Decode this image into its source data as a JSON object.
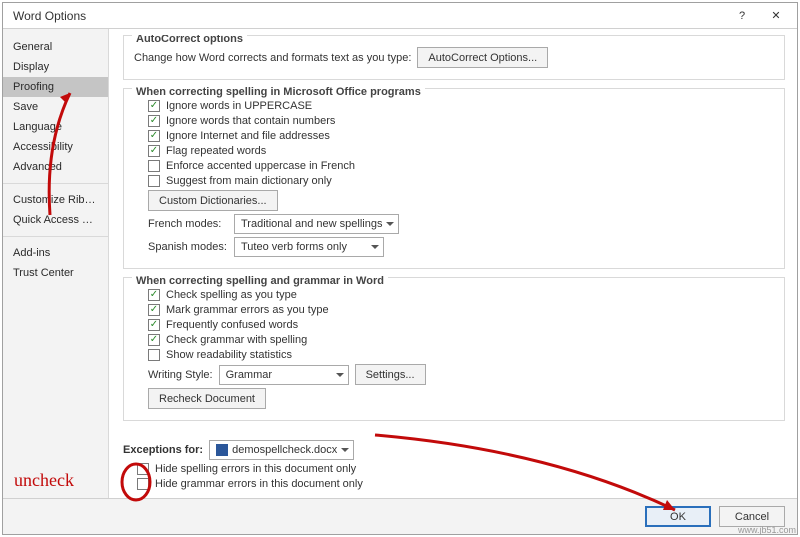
{
  "window": {
    "title": "Word Options",
    "help": "?",
    "close": "✕"
  },
  "sidebar": {
    "items": [
      {
        "label": "General"
      },
      {
        "label": "Display"
      },
      {
        "label": "Proofing",
        "selected": true
      },
      {
        "label": "Save"
      },
      {
        "label": "Language"
      },
      {
        "label": "Accessibility"
      },
      {
        "label": "Advanced"
      }
    ],
    "items2": [
      {
        "label": "Customize Ribbon"
      },
      {
        "label": "Quick Access Toolbar"
      }
    ],
    "items3": [
      {
        "label": "Add-ins"
      },
      {
        "label": "Trust Center"
      }
    ]
  },
  "autocorrect": {
    "section": "AutoCorrect options",
    "text": "Change how Word corrects and formats text as you type:",
    "button": "AutoCorrect Options..."
  },
  "spelling_office": {
    "section": "When correcting spelling in Microsoft Office programs",
    "c1": "Ignore words in UPPERCASE",
    "c2": "Ignore words that contain numbers",
    "c3": "Ignore Internet and file addresses",
    "c4": "Flag repeated words",
    "c5": "Enforce accented uppercase in French",
    "c6": "Suggest from main dictionary only",
    "custom_btn": "Custom Dictionaries...",
    "french_label": "French modes:",
    "french_val": "Traditional and new spellings",
    "spanish_label": "Spanish modes:",
    "spanish_val": "Tuteo verb forms only"
  },
  "spelling_word": {
    "section": "When correcting spelling and grammar in Word",
    "c1": "Check spelling as you type",
    "c2": "Mark grammar errors as you type",
    "c3": "Frequently confused words",
    "c4": "Check grammar with spelling",
    "c5": "Show readability statistics",
    "ws_label": "Writing Style:",
    "ws_val": "Grammar",
    "settings_btn": "Settings...",
    "recheck_btn": "Recheck Document"
  },
  "exceptions": {
    "label": "Exceptions for:",
    "doc": "demospellcheck.docx",
    "c1": "Hide spelling errors in this document only",
    "c2": "Hide grammar errors in this document only"
  },
  "footer": {
    "ok": "OK",
    "cancel": "Cancel"
  },
  "annotation": {
    "uncheck": "uncheck"
  },
  "watermark": "www.jb51.com"
}
